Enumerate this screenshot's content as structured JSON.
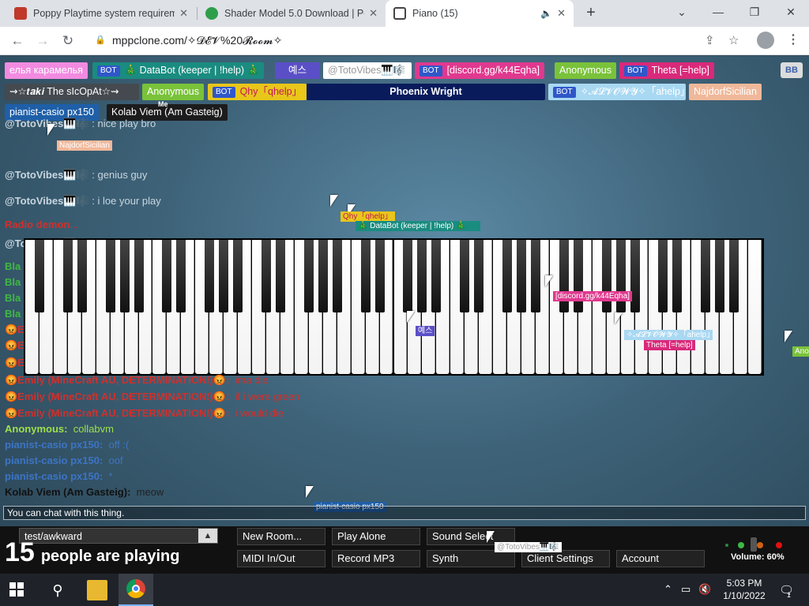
{
  "browser": {
    "tabs": [
      {
        "title": "Poppy Playtime system requirem",
        "favicon_color": "#c0392b"
      },
      {
        "title": "Shader Model 5.0 Download | Pe",
        "favicon_color": "#2e9e4a"
      },
      {
        "title": "Piano (15)",
        "favicon_color": "#555555",
        "active": true
      }
    ],
    "new_tab": "+",
    "url": "mppclone.com/✧𝓓𝓔𝓥%20𝓡𝓸𝓸𝓶✧",
    "window_controls": {
      "minimize": "—",
      "restore": "❐",
      "close": "✕",
      "dropdown": "⌄"
    }
  },
  "users": [
    {
      "name": "елья карамелья",
      "bg": "#f28be0",
      "bot": false
    },
    {
      "name": "🎄 DataBot (keeper | !help) 🎄",
      "bg": "#1a8c80",
      "bot": true
    },
    {
      "name": "예스",
      "bg": "#5b4fc7",
      "bot": false
    },
    {
      "name": "@TotoVibes🎹🎼",
      "bg": "#ffffff",
      "bot": false
    },
    {
      "name": "[discord.gg/k44Eqha]",
      "bg": "#e0398f",
      "bot": true
    },
    {
      "name": "Anonymous",
      "bg": "#7ac23a",
      "bot": false
    },
    {
      "name": "Theta [=help]",
      "bg": "#d9297a",
      "bot": true
    },
    {
      "name": "⇝☆𝒕𝒂𝒌𝒊 The sIcOpAt☆⇝",
      "bg": "#444a4f",
      "bot": false
    },
    {
      "name": "Anonymous",
      "bg": "#7ac23a",
      "bot": false
    },
    {
      "name": "Qhy「qhelp」",
      "bg": "#e8c61a",
      "bot": true
    },
    {
      "name": "Phoenix Wright",
      "bg": "#0a1b5c",
      "bot": false
    },
    {
      "name": "✧𝓐𝓛𝓥𝓞𝓦𝓨✧「ahelp」",
      "bg": "#a9d8f2",
      "bot": true
    },
    {
      "name": "NajdorfSicilian",
      "bg": "#f0b89a",
      "bot": false
    },
    {
      "name": "pianist-casio px150",
      "bg": "#1f5fa8",
      "bot": false
    },
    {
      "name": "Kolab Viem (Am Gasteig)",
      "bg": "#1c1c1c",
      "bot": false
    }
  ],
  "me_label": "Me",
  "bb_button": "BB",
  "chat": [
    {
      "who": "@TotoVibes🎹🎼",
      "msg": "nice play bro",
      "color": "#c9d6e0"
    },
    {
      "who": "@TotoVibes🎹🎼",
      "msg": "genius guy",
      "color": "#c9d6e0"
    },
    {
      "who": "@TotoVibes🎹🎼",
      "msg": "i loe your play",
      "color": "#c9d6e0"
    },
    {
      "who": "Radio demon",
      "msg": "...",
      "color": "#d0302c"
    },
    {
      "who": "@TotoVibes🎹🎼",
      "msg": "",
      "color": "#c9d6e0"
    },
    {
      "who": "Bla",
      "msg": "",
      "color": "#3fb843"
    },
    {
      "who": "Bla",
      "msg": "",
      "color": "#3fb843"
    },
    {
      "who": "Bla",
      "msg": "",
      "color": "#3fb843"
    },
    {
      "who": "Bla",
      "msg": "",
      "color": "#3fb843"
    },
    {
      "who": "😡E",
      "msg": "",
      "color": "#d0302c"
    },
    {
      "who": "😡E",
      "msg": "",
      "color": "#d0302c"
    },
    {
      "who": "😡E",
      "msg": "",
      "color": "#d0302c"
    },
    {
      "who": "😡Emily (MineCraft AU, DETERMINATION!)😡:",
      "msg": "ima die",
      "color": "#d0302c"
    },
    {
      "who": "😡Emily (MineCraft AU, DETERMINATION!)😡:",
      "msg": "if i were green",
      "color": "#d0302c"
    },
    {
      "who": "😡Emily (MineCraft AU, DETERMINATION!)😡:",
      "msg": "i would die",
      "color": "#d0302c"
    },
    {
      "who": "Anonymous:",
      "msg": "collabvm",
      "color": "#9fe04a"
    },
    {
      "who": "pianist-casio px150:",
      "msg": "off :(",
      "color": "#3d74c4"
    },
    {
      "who": "pianist-casio px150:",
      "msg": "oof",
      "color": "#3d74c4"
    },
    {
      "who": "pianist-casio px150:",
      "msg": "*",
      "color": "#3d74c4"
    },
    {
      "who": "Kolab Viem (Am Gasteig):",
      "msg": "meow",
      "color": "#111111"
    }
  ],
  "cursor_tags": [
    {
      "name": "NajdorfSicilian",
      "bg": "#f0b89a"
    },
    {
      "name": "Qhy「qhelp」",
      "bg": "#e8c61a"
    },
    {
      "name": "🎄 DataBot (keeper | !help) 🎄",
      "bg": "#1a8c80"
    },
    {
      "name": "[discord.gg/k44Eqha]",
      "bg": "#e0398f"
    },
    {
      "name": "예스",
      "bg": "#5b4fc7"
    },
    {
      "name": "✧𝓐𝓛𝓥𝓞𝓦𝓨✧「ahelp」",
      "bg": "#a9d8f2"
    },
    {
      "name": "Theta [=help]",
      "bg": "#d9297a"
    },
    {
      "name": "Ano",
      "bg": "#7ac23a"
    },
    {
      "name": "pianist-casio px150",
      "bg": "#1f5fa8"
    },
    {
      "name": "@TotoVibes🎹🎼",
      "bg": "#ffffff"
    }
  ],
  "chat_input_placeholder": "You can chat with this thing.",
  "room": {
    "name": "test/awkward",
    "arrow": "▲"
  },
  "players": {
    "count": "15",
    "text": "people are playing"
  },
  "controls": [
    "New Room...",
    "Play Alone",
    "Sound Select",
    "MIDI In/Out",
    "Record MP3",
    "Synth",
    "Client Settings",
    "Account"
  ],
  "volume": "Volume: 60%",
  "taskbar": {
    "time": "5:03 PM",
    "date": "1/10/2022",
    "notifications": "1"
  }
}
